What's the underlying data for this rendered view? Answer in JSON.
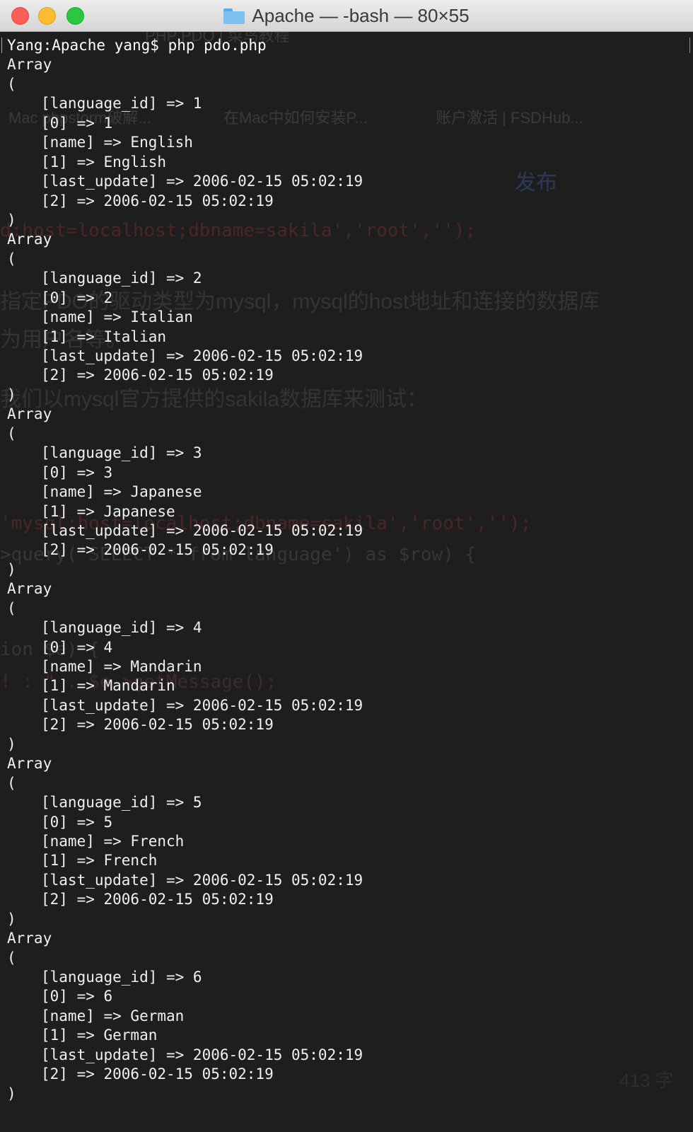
{
  "window": {
    "title": "Apache — -bash — 80×55"
  },
  "terminal": {
    "prompt": "Yang:Apache yang$ ",
    "command": "php pdo.php",
    "arrays": [
      {
        "open": "Array",
        "paren_open": "(",
        "lines": [
          "[language_id] => 1",
          "[0] => 1",
          "[name] => English",
          "[1] => English",
          "[last_update] => 2006-02-15 05:02:19",
          "[2] => 2006-02-15 05:02:19"
        ],
        "paren_close": ")"
      },
      {
        "open": "Array",
        "paren_open": "(",
        "lines": [
          "[language_id] => 2",
          "[0] => 2",
          "[name] => Italian",
          "[1] => Italian",
          "[last_update] => 2006-02-15 05:02:19",
          "[2] => 2006-02-15 05:02:19"
        ],
        "paren_close": ")"
      },
      {
        "open": "Array",
        "paren_open": "(",
        "lines": [
          "[language_id] => 3",
          "[0] => 3",
          "[name] => Japanese",
          "[1] => Japanese",
          "[last_update] => 2006-02-15 05:02:19",
          "[2] => 2006-02-15 05:02:19"
        ],
        "paren_close": ")"
      },
      {
        "open": "Array",
        "paren_open": "(",
        "lines": [
          "[language_id] => 4",
          "[0] => 4",
          "[name] => Mandarin",
          "[1] => Mandarin",
          "[last_update] => 2006-02-15 05:02:19",
          "[2] => 2006-02-15 05:02:19"
        ],
        "paren_close": ")"
      },
      {
        "open": "Array",
        "paren_open": "(",
        "lines": [
          "[language_id] => 5",
          "[0] => 5",
          "[name] => French",
          "[1] => French",
          "[last_update] => 2006-02-15 05:02:19",
          "[2] => 2006-02-15 05:02:19"
        ],
        "paren_close": ")"
      },
      {
        "open": "Array",
        "paren_open": "(",
        "lines": [
          "[language_id] => 6",
          "[0] => 6",
          "[name] => German",
          "[1] => German",
          "[last_update] => 2006-02-15 05:02:19",
          "[2] => 2006-02-15 05:02:19"
        ],
        "paren_close": ")"
      }
    ]
  },
  "background_ghost": {
    "tab1": "PHP PDO | 菜鸟教程",
    "bookmark1": "Mac phpstorm破解...",
    "bookmark2": "在Mac中如何安装P...",
    "bookmark3": "账户激活 | FSDHub...",
    "publish": "发布",
    "code1": "d:host=localhost;dbname=sakila','root','');",
    "text1": "指定PDO的驱动类型为mysql，mysql的host地址和连接的数据库",
    "text2": "为用户名等。",
    "text3": "我们以mysql官方提供的sakila数据库来测试：",
    "code2": "'mysql:host=localhost;dbname=sakila','root','');",
    "code3": ">query('SELECT * from language') as $row) {",
    "code4": "ion $e) {",
    "code5": "! : \" . $e->getMessage();",
    "word_count": "413 字"
  },
  "colors": {
    "terminal_bg": "#1e1e1e",
    "terminal_fg": "#f0f0f0",
    "ghost_red": "#5a2a2a",
    "ghost_gray": "#3a3a3a"
  }
}
